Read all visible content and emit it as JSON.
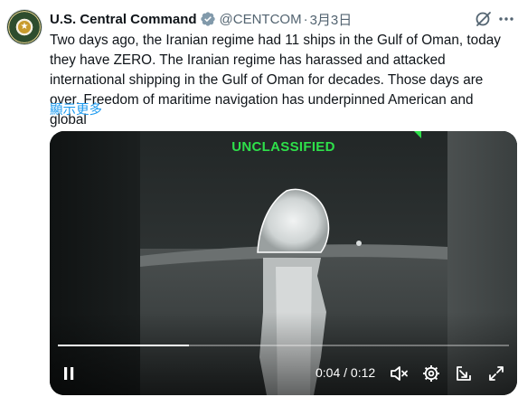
{
  "post": {
    "author": {
      "display_name": "U.S. Central Command",
      "handle": "@CENTCOM",
      "timestamp": "3月3日",
      "separator": "·",
      "avatar_icon": "centcom-seal-icon",
      "verified_icon": "verified-badge-icon"
    },
    "text": "Two days ago, the Iranian regime had 11 ships in the Gulf of Oman, today they have ZERO. The Iranian regime has harassed and attacked international shipping in the Gulf of Oman for decades. Those days are over. Freedom of maritime navigation has underpinned American and global",
    "show_more": "顯示更多",
    "actions": {
      "grok_icon": "grok-icon",
      "more_icon": "more-options-icon"
    }
  },
  "video": {
    "overlay_text": "UNCLASSIFIED",
    "current_time": "0:04",
    "duration": "0:12",
    "time_separator": " / ",
    "progress": 0.29,
    "controls": {
      "play_pause_icon": "pause-icon",
      "mute_icon": "muted-volume-icon",
      "settings_icon": "settings-gear-icon",
      "popout_icon": "popout-icon",
      "fullscreen_icon": "fullscreen-icon"
    }
  },
  "colors": {
    "text": "#0f1419",
    "secondary": "#536471",
    "link": "#1d9bf0",
    "verified": "#829aab",
    "overlay_green": "#2ee04a"
  }
}
